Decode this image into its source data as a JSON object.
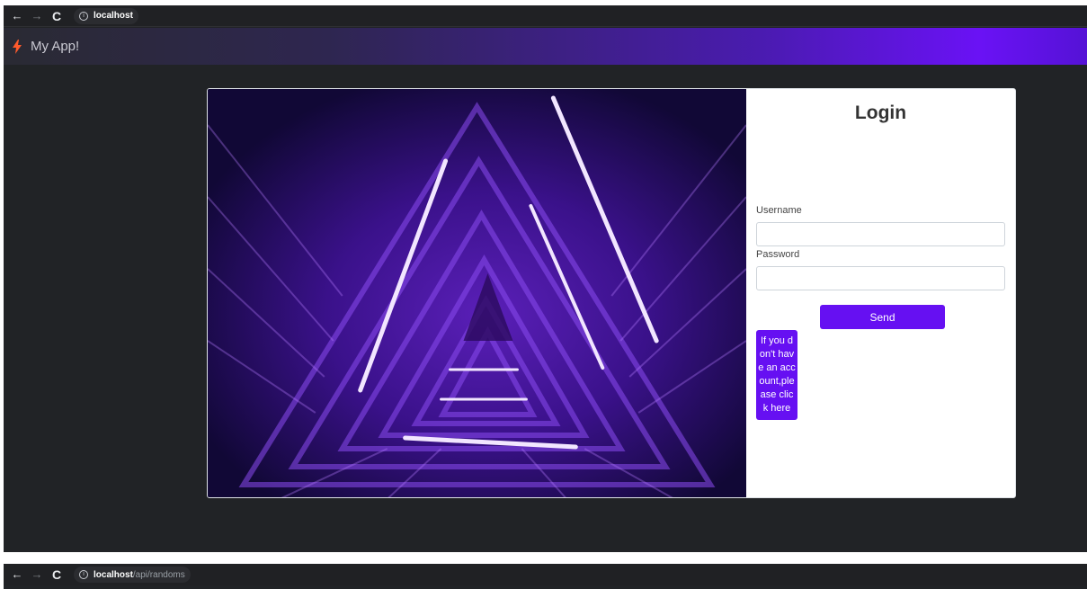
{
  "browser1": {
    "url_host": "localhost",
    "url_path": "",
    "back": "←",
    "forward": "→",
    "reload": "C"
  },
  "browser2": {
    "url_host": "localhost",
    "url_path": "/api/randoms",
    "back": "←",
    "forward": "→",
    "reload": "C"
  },
  "navbar": {
    "brand": "My App!",
    "gradient_end_color": "#6a12f5"
  },
  "login": {
    "title": "Login",
    "username_label": "Username",
    "username_value": "",
    "password_label": "Password",
    "password_value": "",
    "send_label": "Send",
    "register_label": "If you don't have an account,please click here",
    "accent_color": "#6610f2"
  },
  "icons": {
    "info": "info-icon",
    "brand": "bolt-icon",
    "back": "arrow-left-icon",
    "forward": "arrow-right-icon",
    "reload": "reload-icon"
  }
}
